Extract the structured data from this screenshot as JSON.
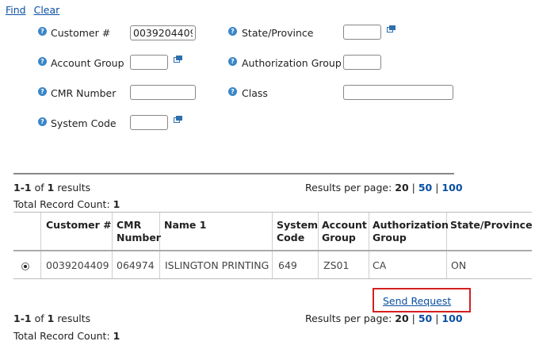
{
  "toolbar": {
    "find_label": "Find",
    "clear_label": "Clear"
  },
  "form": {
    "customer_label": "Customer #",
    "customer_value": "0039204409",
    "account_group_label": "Account Group",
    "cmr_number_label": "CMR Number",
    "system_code_label": "System Code",
    "state_label": "State/Province",
    "authorization_group_label": "Authorization Group",
    "class_label": "Class"
  },
  "results_top": {
    "range": "1-1",
    "of": "of",
    "total": "1",
    "word": "results",
    "per_page_label": "Results per page:",
    "per_page_selected": "20",
    "per_page_options": [
      "50",
      "100"
    ],
    "record_count_label": "Total Record Count:",
    "record_count_value": "1"
  },
  "table": {
    "headers": [
      "Customer #",
      "CMR Number",
      "Name 1",
      "System Code",
      "Account Group",
      "Authorization Group",
      "State/Province"
    ],
    "rows": [
      {
        "customer": "0039204409",
        "cmr": "064974",
        "name": "ISLINGTON PRINTING",
        "system_code": "649",
        "account_group": "ZS01",
        "authorization_group": "CA",
        "state": "ON",
        "selected": true
      }
    ]
  },
  "send_request_label": "Send Request",
  "results_bottom": {
    "range": "1-1",
    "of": "of",
    "total": "1",
    "word": "results",
    "per_page_label": "Results per page:",
    "per_page_selected": "20",
    "per_page_options": [
      "50",
      "100"
    ],
    "record_count_label": "Total Record Count:",
    "record_count_value": "1"
  },
  "colors": {
    "link": "#0a4fa3",
    "help_icon": "#3a86c8",
    "highlight_border": "#d32020"
  },
  "icons": {
    "help": "help-icon",
    "lookup": "lookup-icon"
  }
}
